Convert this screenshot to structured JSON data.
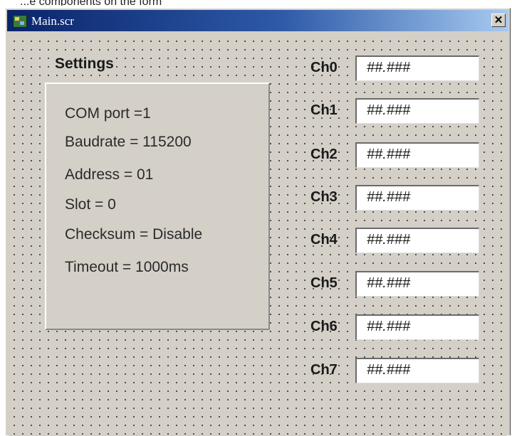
{
  "window": {
    "title": "Main.scr",
    "close_glyph": "✕",
    "icon": "app-icon"
  },
  "caption_cutoff": "...e components on the form",
  "settings": {
    "title": "Settings",
    "lines": [
      "COM port =1",
      "Baudrate = 115200",
      "Address = 01",
      "Slot = 0",
      "Checksum = Disable",
      "Timeout = 1000ms"
    ]
  },
  "channels": [
    {
      "label": "Ch0",
      "value": "##.###"
    },
    {
      "label": "Ch1",
      "value": "##.###"
    },
    {
      "label": "Ch2",
      "value": "##.###"
    },
    {
      "label": "Ch3",
      "value": "##.###"
    },
    {
      "label": "Ch4",
      "value": "##.###"
    },
    {
      "label": "Ch5",
      "value": "##.###"
    },
    {
      "label": "Ch6",
      "value": "##.###"
    },
    {
      "label": "Ch7",
      "value": "##.###"
    }
  ],
  "colors": {
    "titlebar": "#0a246a",
    "form_background": "#d4d0c8",
    "field_background": "#ffffff"
  }
}
